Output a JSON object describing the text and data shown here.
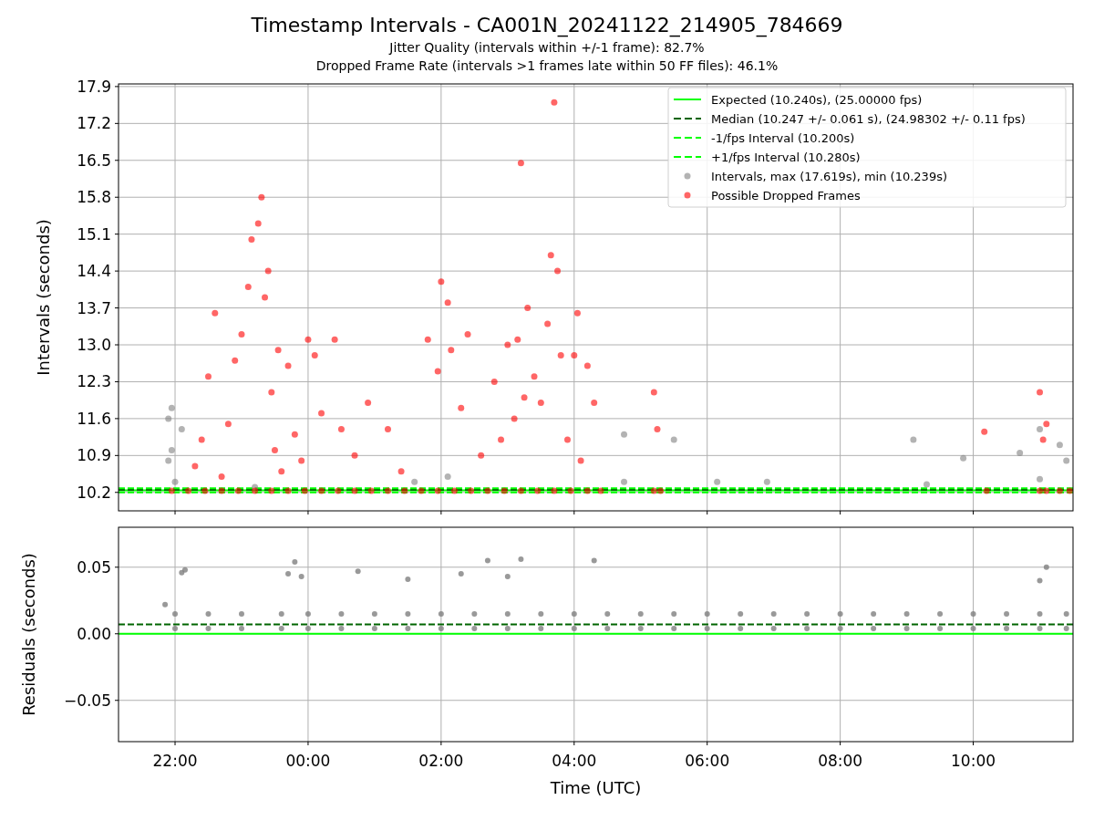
{
  "title": "Timestamp Intervals - CA001N_20241122_214905_784669",
  "subtitles": [
    "Jitter Quality (intervals within +/-1 frame): 82.7%",
    "Dropped Frame Rate (intervals >1 frames late within 50 FF files): 46.1%"
  ],
  "panels": [
    {
      "chart_data": {
        "type": "scatter",
        "ylabel": "Intervals (seconds)",
        "xlim": [
          "2024-11-22T21:09",
          "2024-11-23T11:30"
        ],
        "ylim": [
          9.85,
          17.95
        ],
        "grid": true,
        "legend": true,
        "yticks": [
          {
            "value": 10.2,
            "label": "10.2"
          },
          {
            "value": 10.9,
            "label": "10.9"
          },
          {
            "value": 11.6,
            "label": "11.6"
          },
          {
            "value": 12.3,
            "label": "12.3"
          },
          {
            "value": 13.0,
            "label": "13.0"
          },
          {
            "value": 13.7,
            "label": "13.7"
          },
          {
            "value": 14.4,
            "label": "14.4"
          },
          {
            "value": 15.1,
            "label": "15.1"
          },
          {
            "value": 15.8,
            "label": "15.8"
          },
          {
            "value": 16.5,
            "label": "16.5"
          },
          {
            "value": 17.2,
            "label": "17.2"
          },
          {
            "value": 17.9,
            "label": "17.9"
          }
        ],
        "ref_lines": [
          {
            "axis": "y",
            "value": 10.24,
            "label": "Expected (10.240s), (25.00000 fps)",
            "color": "#00ff00"
          },
          {
            "axis": "y",
            "value": 10.247,
            "label": "Median (10.247 +/- 0.061 s), (24.98302 +/- 0.11 fps)",
            "color": "#006400"
          },
          {
            "axis": "y",
            "value": 10.2,
            "label": "-1/fps Interval (10.200s)",
            "color": "#00ff00"
          },
          {
            "axis": "y",
            "value": 10.28,
            "label": "+1/fps Interval (10.280s)",
            "color": "#00ff00"
          }
        ],
        "series": [
          {
            "name": "Intervals, max (17.619s), min (10.239s)",
            "color": "#808080",
            "x": [
              "2024-11-22T21:54",
              "2024-11-22T21:57",
              "2024-11-22T21:54",
              "2024-11-22T21:57",
              "2024-11-22T22:00",
              "2024-11-22T22:06",
              "2024-11-22T23:12",
              "2024-11-23T01:36",
              "2024-11-23T02:06",
              "2024-11-23T04:45",
              "2024-11-23T04:45",
              "2024-11-23T05:30",
              "2024-11-23T06:09",
              "2024-11-23T06:54",
              "2024-11-23T09:06",
              "2024-11-23T09:18",
              "2024-11-23T09:51",
              "2024-11-23T10:42",
              "2024-11-23T11:00",
              "2024-11-23T11:00",
              "2024-11-23T11:18",
              "2024-11-23T11:24"
            ],
            "values": [
              11.6,
              11.8,
              10.8,
              11.0,
              10.4,
              11.4,
              10.3,
              10.4,
              10.5,
              11.3,
              10.4,
              11.2,
              10.4,
              10.4,
              11.2,
              10.35,
              10.85,
              10.95,
              11.4,
              10.45,
              11.1,
              10.8
            ]
          },
          {
            "name": "Possible Dropped Frames",
            "color": "#ff0000",
            "x": [
              "2024-11-22T22:18",
              "2024-11-22T22:24",
              "2024-11-22T22:30",
              "2024-11-22T22:36",
              "2024-11-22T22:42",
              "2024-11-22T22:48",
              "2024-11-22T22:54",
              "2024-11-22T23:00",
              "2024-11-22T23:06",
              "2024-11-22T23:09",
              "2024-11-22T23:15",
              "2024-11-22T23:18",
              "2024-11-22T23:21",
              "2024-11-22T23:24",
              "2024-11-22T23:27",
              "2024-11-22T23:30",
              "2024-11-22T23:33",
              "2024-11-22T23:36",
              "2024-11-22T23:42",
              "2024-11-22T23:48",
              "2024-11-22T23:54",
              "2024-11-23T00:00",
              "2024-11-23T00:06",
              "2024-11-23T00:12",
              "2024-11-23T00:24",
              "2024-11-23T00:30",
              "2024-11-23T00:42",
              "2024-11-23T00:54",
              "2024-11-23T01:12",
              "2024-11-23T01:24",
              "2024-11-23T01:48",
              "2024-11-23T01:57",
              "2024-11-23T02:00",
              "2024-11-23T02:06",
              "2024-11-23T02:09",
              "2024-11-23T02:18",
              "2024-11-23T02:24",
              "2024-11-23T02:36",
              "2024-11-23T02:48",
              "2024-11-23T02:54",
              "2024-11-23T03:00",
              "2024-11-23T03:06",
              "2024-11-23T03:12",
              "2024-11-23T03:15",
              "2024-11-23T03:18",
              "2024-11-23T03:09",
              "2024-11-23T03:24",
              "2024-11-23T03:30",
              "2024-11-23T03:36",
              "2024-11-23T03:39",
              "2024-11-23T03:42",
              "2024-11-23T03:45",
              "2024-11-23T03:48",
              "2024-11-23T03:54",
              "2024-11-23T04:00",
              "2024-11-23T04:03",
              "2024-11-23T04:12",
              "2024-11-23T04:18",
              "2024-11-23T04:06",
              "2024-11-23T05:12",
              "2024-11-23T05:15",
              "2024-11-23T10:10",
              "2024-11-23T11:00",
              "2024-11-23T11:03",
              "2024-11-23T11:06",
              "2024-11-22T21:57",
              "2024-11-22T22:12",
              "2024-11-22T22:27",
              "2024-11-22T22:42",
              "2024-11-22T22:57",
              "2024-11-22T23:12",
              "2024-11-22T23:27",
              "2024-11-22T23:42",
              "2024-11-22T23:57",
              "2024-11-23T00:12",
              "2024-11-23T00:27",
              "2024-11-23T00:42",
              "2024-11-23T00:57",
              "2024-11-23T01:12",
              "2024-11-23T01:27",
              "2024-11-23T01:42",
              "2024-11-23T01:57",
              "2024-11-23T02:12",
              "2024-11-23T02:27",
              "2024-11-23T02:42",
              "2024-11-23T02:57",
              "2024-11-23T03:12",
              "2024-11-23T03:27",
              "2024-11-23T03:42",
              "2024-11-23T03:57",
              "2024-11-23T04:12",
              "2024-11-23T04:24",
              "2024-11-23T05:12",
              "2024-11-23T05:18",
              "2024-11-23T10:12",
              "2024-11-23T11:00",
              "2024-11-23T11:06",
              "2024-11-23T11:18",
              "2024-11-23T11:27"
            ],
            "values": [
              10.7,
              11.2,
              12.4,
              13.6,
              10.5,
              11.5,
              12.7,
              13.2,
              14.1,
              15.0,
              15.3,
              15.8,
              13.9,
              14.4,
              12.1,
              11.0,
              12.9,
              10.6,
              12.6,
              11.3,
              10.8,
              13.1,
              12.8,
              11.7,
              13.1,
              11.4,
              10.9,
              11.9,
              11.4,
              10.6,
              13.1,
              12.5,
              14.2,
              13.8,
              12.9,
              11.8,
              13.2,
              10.9,
              12.3,
              11.2,
              13.0,
              11.6,
              16.45,
              12.0,
              13.7,
              13.1,
              12.4,
              11.9,
              13.4,
              14.7,
              17.6,
              14.4,
              12.8,
              11.2,
              12.8,
              13.6,
              12.6,
              11.9,
              10.8,
              12.1,
              11.4,
              11.35,
              12.1,
              11.2,
              11.5,
              10.23,
              10.23,
              10.23,
              10.23,
              10.23,
              10.23,
              10.23,
              10.23,
              10.23,
              10.23,
              10.23,
              10.23,
              10.23,
              10.23,
              10.23,
              10.23,
              10.23,
              10.23,
              10.23,
              10.23,
              10.23,
              10.23,
              10.23,
              10.23,
              10.23,
              10.23,
              10.23,
              10.23,
              10.23,
              10.23,
              10.23,
              10.23,
              10.23,
              10.23
            ]
          }
        ]
      }
    },
    {
      "chart_data": {
        "type": "scatter",
        "xlabel": "Time (UTC)",
        "ylabel": "Residuals (seconds)",
        "xlim": [
          "2024-11-22T21:09",
          "2024-11-23T11:30"
        ],
        "ylim": [
          -0.081,
          0.08
        ],
        "grid": true,
        "xticks": [
          {
            "value": "2024-11-22T22:00",
            "label": "22:00"
          },
          {
            "value": "2024-11-23T00:00",
            "label": "00:00"
          },
          {
            "value": "2024-11-23T02:00",
            "label": "02:00"
          },
          {
            "value": "2024-11-23T04:00",
            "label": "04:00"
          },
          {
            "value": "2024-11-23T06:00",
            "label": "06:00"
          },
          {
            "value": "2024-11-23T08:00",
            "label": "08:00"
          },
          {
            "value": "2024-11-23T10:00",
            "label": "10:00"
          }
        ],
        "yticks": [
          {
            "value": -0.05,
            "label": "−0.05"
          },
          {
            "value": 0,
            "label": "0.00"
          },
          {
            "value": 0.05,
            "label": "0.05"
          }
        ],
        "ref_lines": [
          {
            "axis": "y",
            "value": 0,
            "color": "#00ff00"
          },
          {
            "axis": "y",
            "value": 0.007,
            "color": "#006400"
          }
        ],
        "series": [
          {
            "color": "#808080",
            "x": [
              "2024-11-22T21:51",
              "2024-11-22T22:06",
              "2024-11-22T22:09",
              "2024-11-22T23:42",
              "2024-11-22T23:48",
              "2024-11-22T23:54",
              "2024-11-23T00:45",
              "2024-11-23T01:30",
              "2024-11-23T02:18",
              "2024-11-23T02:42",
              "2024-11-23T03:00",
              "2024-11-23T03:12",
              "2024-11-23T04:18",
              "2024-11-23T11:00",
              "2024-11-23T11:06",
              "2024-11-22T22:00",
              "2024-11-22T22:00",
              "2024-11-22T22:30",
              "2024-11-22T22:30",
              "2024-11-22T23:00",
              "2024-11-22T23:00",
              "2024-11-22T23:36",
              "2024-11-22T23:36",
              "2024-11-23T00:00",
              "2024-11-23T00:00",
              "2024-11-23T00:30",
              "2024-11-23T00:30",
              "2024-11-23T01:00",
              "2024-11-23T01:00",
              "2024-11-23T01:30",
              "2024-11-23T01:30",
              "2024-11-23T02:00",
              "2024-11-23T02:00",
              "2024-11-23T02:30",
              "2024-11-23T02:30",
              "2024-11-23T03:00",
              "2024-11-23T03:00",
              "2024-11-23T03:30",
              "2024-11-23T03:30",
              "2024-11-23T04:00",
              "2024-11-23T04:00",
              "2024-11-23T04:30",
              "2024-11-23T04:30",
              "2024-11-23T05:00",
              "2024-11-23T05:00",
              "2024-11-23T05:30",
              "2024-11-23T05:30",
              "2024-11-23T06:00",
              "2024-11-23T06:00",
              "2024-11-23T06:30",
              "2024-11-23T06:30",
              "2024-11-23T07:00",
              "2024-11-23T07:00",
              "2024-11-23T07:30",
              "2024-11-23T07:30",
              "2024-11-23T08:00",
              "2024-11-23T08:00",
              "2024-11-23T08:30",
              "2024-11-23T08:30",
              "2024-11-23T09:00",
              "2024-11-23T09:00",
              "2024-11-23T09:30",
              "2024-11-23T09:30",
              "2024-11-23T10:00",
              "2024-11-23T10:00",
              "2024-11-23T10:30",
              "2024-11-23T10:30",
              "2024-11-23T11:00",
              "2024-11-23T11:00",
              "2024-11-23T11:24",
              "2024-11-23T11:24"
            ],
            "values": [
              0.022,
              0.046,
              0.048,
              0.045,
              0.054,
              0.043,
              0.047,
              0.041,
              0.045,
              0.055,
              0.043,
              0.056,
              0.055,
              0.04,
              0.05,
              0.015,
              0.004,
              0.015,
              0.004,
              0.015,
              0.004,
              0.015,
              0.004,
              0.015,
              0.004,
              0.015,
              0.004,
              0.015,
              0.004,
              0.015,
              0.004,
              0.015,
              0.004,
              0.015,
              0.004,
              0.015,
              0.004,
              0.015,
              0.004,
              0.015,
              0.004,
              0.015,
              0.004,
              0.015,
              0.004,
              0.015,
              0.004,
              0.015,
              0.004,
              0.015,
              0.004,
              0.015,
              0.004,
              0.015,
              0.004,
              0.015,
              0.004,
              0.015,
              0.004,
              0.015,
              0.004,
              0.015,
              0.004,
              0.015,
              0.004,
              0.015,
              0.004,
              0.015,
              0.004,
              0.015,
              0.004
            ]
          }
        ]
      }
    }
  ]
}
